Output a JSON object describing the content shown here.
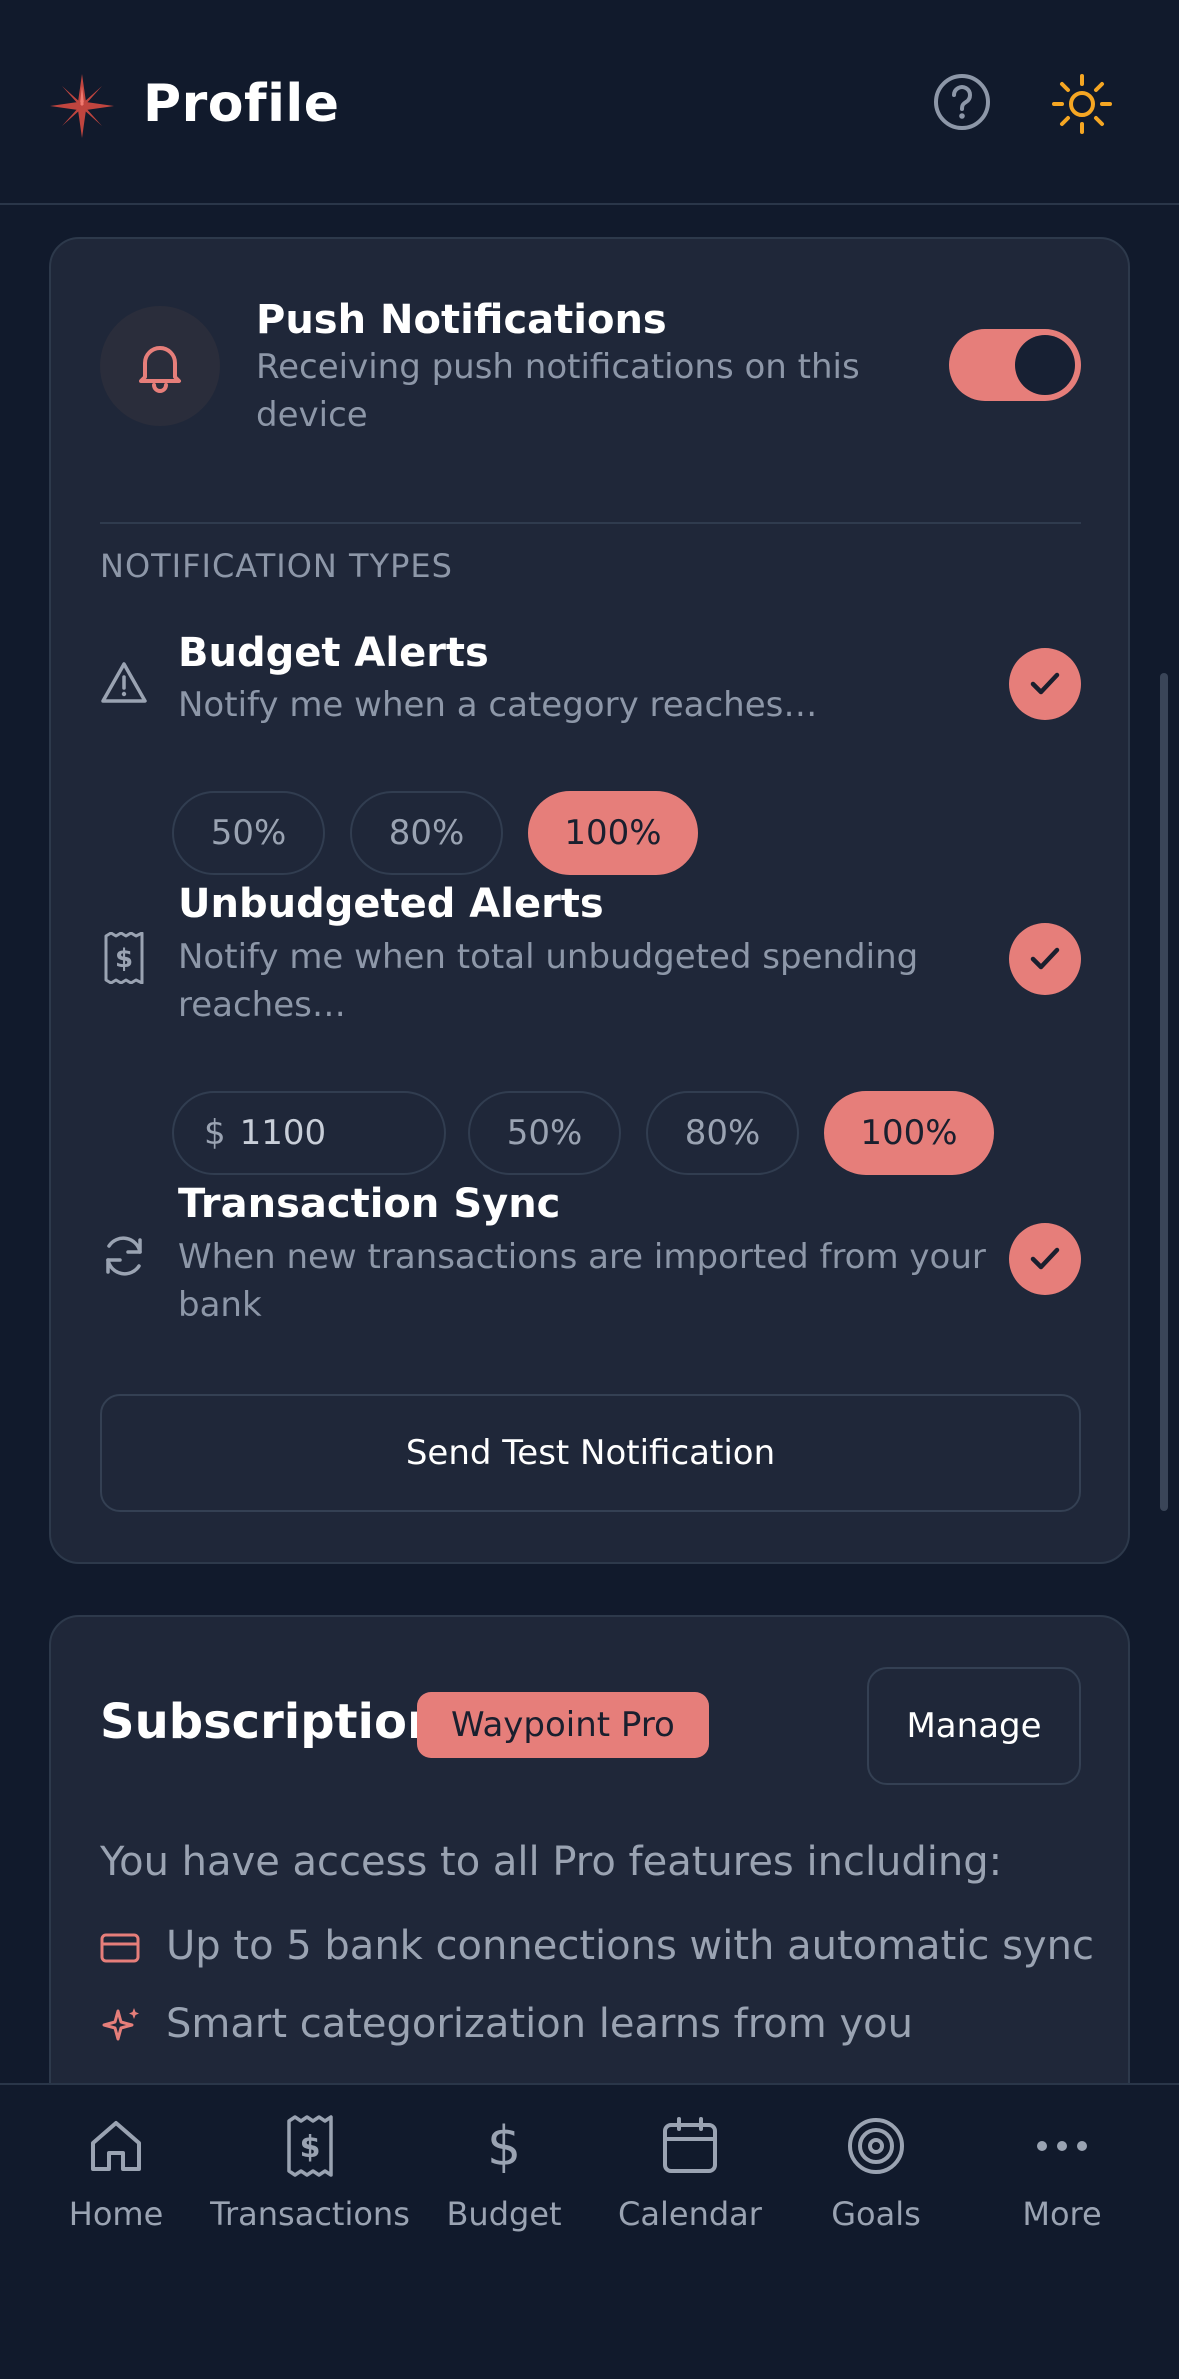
{
  "header": {
    "title": "Profile",
    "logo_icon": "compass-star-icon",
    "help_icon": "help-circle-icon",
    "theme_icon": "sun-icon"
  },
  "push": {
    "title": "Push Notifications",
    "description_line1": "Receiving push notifications on this",
    "description_line2": "device",
    "enabled": true
  },
  "notification_types": {
    "label": "NOTIFICATION TYPES",
    "budget_alerts": {
      "title": "Budget Alerts",
      "description": "Notify me when a category reaches…",
      "checked": true,
      "chips": [
        "50%",
        "80%",
        "100%"
      ],
      "selected": "100%"
    },
    "unbudgeted_alerts": {
      "title": "Unbudgeted Alerts",
      "description_line1": "Notify me when total unbudgeted spending",
      "description_line2": "reaches…",
      "checked": true,
      "currency": "$",
      "amount": "1100",
      "chips": [
        "50%",
        "80%",
        "100%"
      ],
      "selected": "100%"
    },
    "transaction_sync": {
      "title": "Transaction Sync",
      "description_line1": "When new transactions are imported from your",
      "description_line2": "bank",
      "checked": true
    }
  },
  "test_button_label": "Send Test Notification",
  "subscription": {
    "title": "Subscription",
    "badge": "Waypoint Pro",
    "manage_label": "Manage",
    "description": "You have access to all Pro features including:",
    "features": [
      "Up to 5 bank connections with automatic sync",
      "Smart categorization learns from you"
    ]
  },
  "nav": {
    "items": [
      {
        "label": "Home",
        "icon": "home-icon"
      },
      {
        "label": "Transactions",
        "icon": "receipt-icon"
      },
      {
        "label": "Budget",
        "icon": "dollar-icon"
      },
      {
        "label": "Calendar",
        "icon": "calendar-icon"
      },
      {
        "label": "Goals",
        "icon": "target-icon"
      },
      {
        "label": "More",
        "icon": "more-dots-icon"
      }
    ]
  },
  "colors": {
    "accent": "#e67e7a",
    "background": "#111a2c",
    "card": "#1f2739",
    "muted_text": "#8d97a8",
    "sun": "#f5a623"
  }
}
